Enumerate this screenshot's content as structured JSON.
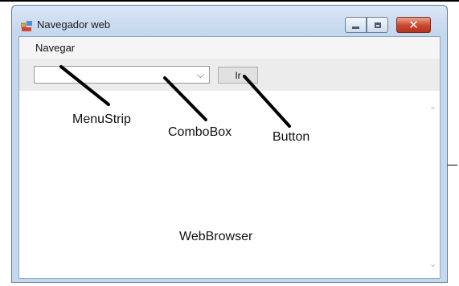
{
  "window": {
    "title": "Navegador web",
    "close_glyph": "✕",
    "icons": [
      "app-icon",
      "minimize-icon",
      "maximize-icon",
      "close-icon"
    ]
  },
  "menu": {
    "items": [
      {
        "label": "Navegar"
      }
    ]
  },
  "toolbar": {
    "combobox_value": "",
    "combobox_arrow": "⌵",
    "go_button_label": "Ir"
  },
  "browser": {
    "scroll_up_glyph": "⌃",
    "scroll_down_glyph": "⌄"
  },
  "annotations": {
    "menustrip": "MenuStrip",
    "combobox": "ComboBox",
    "button": "Button",
    "webbrowser": "WebBrowser"
  },
  "colors": {
    "window_frame": "#c4d8ee",
    "close_button": "#c9452c",
    "annotation_arrow": "#000000"
  }
}
